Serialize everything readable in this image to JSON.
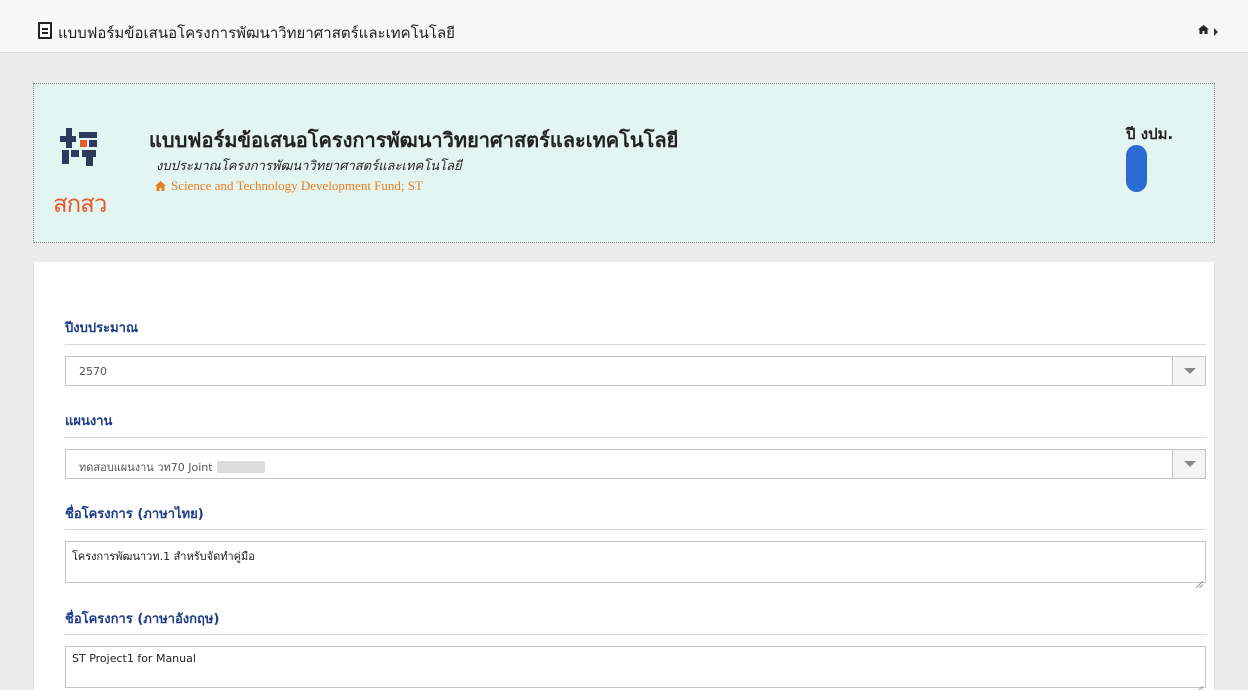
{
  "topbar": {
    "title": "แบบฟอร์มข้อเสนอโครงการพัฒนาวิทยาศาสตร์และเทคโนโลยี",
    "home_icon": "home-icon",
    "caret_icon": "caret-right-icon"
  },
  "header": {
    "logo_text": "สกสว",
    "title": "แบบฟอร์มข้อเสนอโครงการพัฒนาวิทยาศาสตร์และเทคโนโลยี",
    "subtitle": "งบประมาณโครงการพัฒนาวิทยาศาสตร์และเทคโนโลยี",
    "fund": "Science and Technology Development Fund; ST",
    "year_label": "ปี งปม.",
    "year_toggle_on": true,
    "accent_color": "#2d6bd4",
    "fund_color": "#e67e22",
    "panel_color": "#e3f5f1"
  },
  "form": {
    "fiscal_year": {
      "label": "ปีงบประมาณ",
      "value": "2570"
    },
    "plan": {
      "label": "แผนงาน",
      "value": "ทดสอบแผนงาน วท70 Joint"
    },
    "name_th": {
      "label": "ชื่อโครงการ (ภาษาไทย)",
      "value": "โครงการพัฒนาวท.1 สำหรับจัดทำคู่มือ"
    },
    "name_en": {
      "label": "ชื่อโครงการ (ภาษาอังกฤษ)",
      "value": "ST Project1 for Manual"
    },
    "label_color": "#1f3c88"
  }
}
